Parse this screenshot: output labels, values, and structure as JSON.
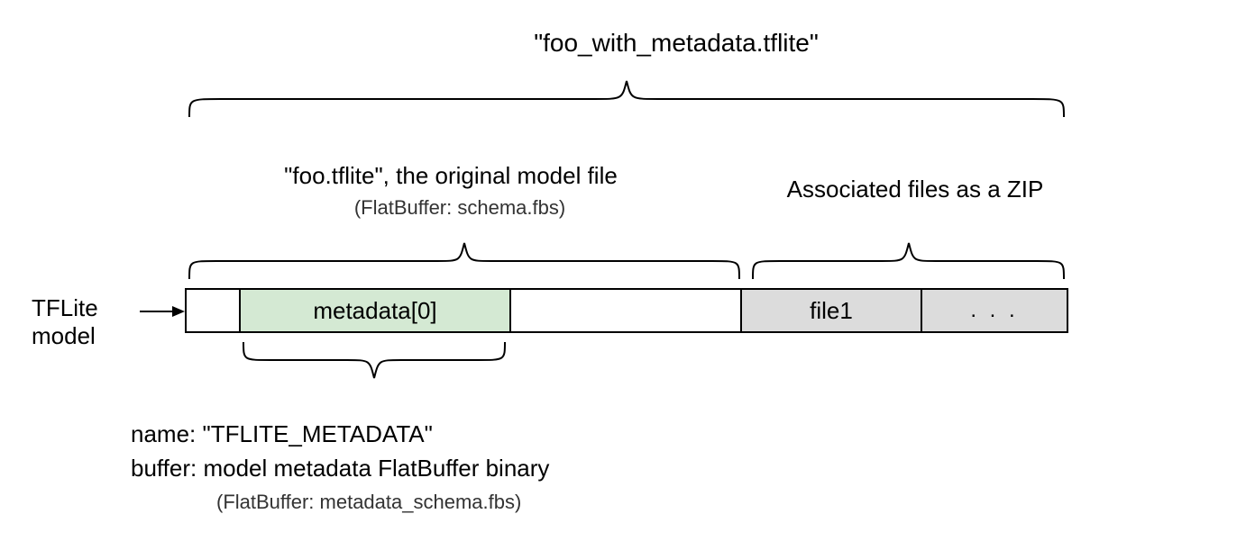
{
  "top_title": "\"foo_with_metadata.tflite\"",
  "section1": {
    "title": "\"foo.tflite\", the original model file",
    "sub": "(FlatBuffer: schema.fbs)"
  },
  "section2": {
    "title": "Associated files as a ZIP"
  },
  "left_label_line1": "TFLite",
  "left_label_line2": "model",
  "cells": {
    "metadata": "metadata[0]",
    "file1": "file1",
    "dots": ". . ."
  },
  "meta_detail": {
    "name": "name: \"TFLITE_METADATA\"",
    "buffer": "buffer: model metadata FlatBuffer binary",
    "sub": "(FlatBuffer: metadata_schema.fbs)"
  }
}
